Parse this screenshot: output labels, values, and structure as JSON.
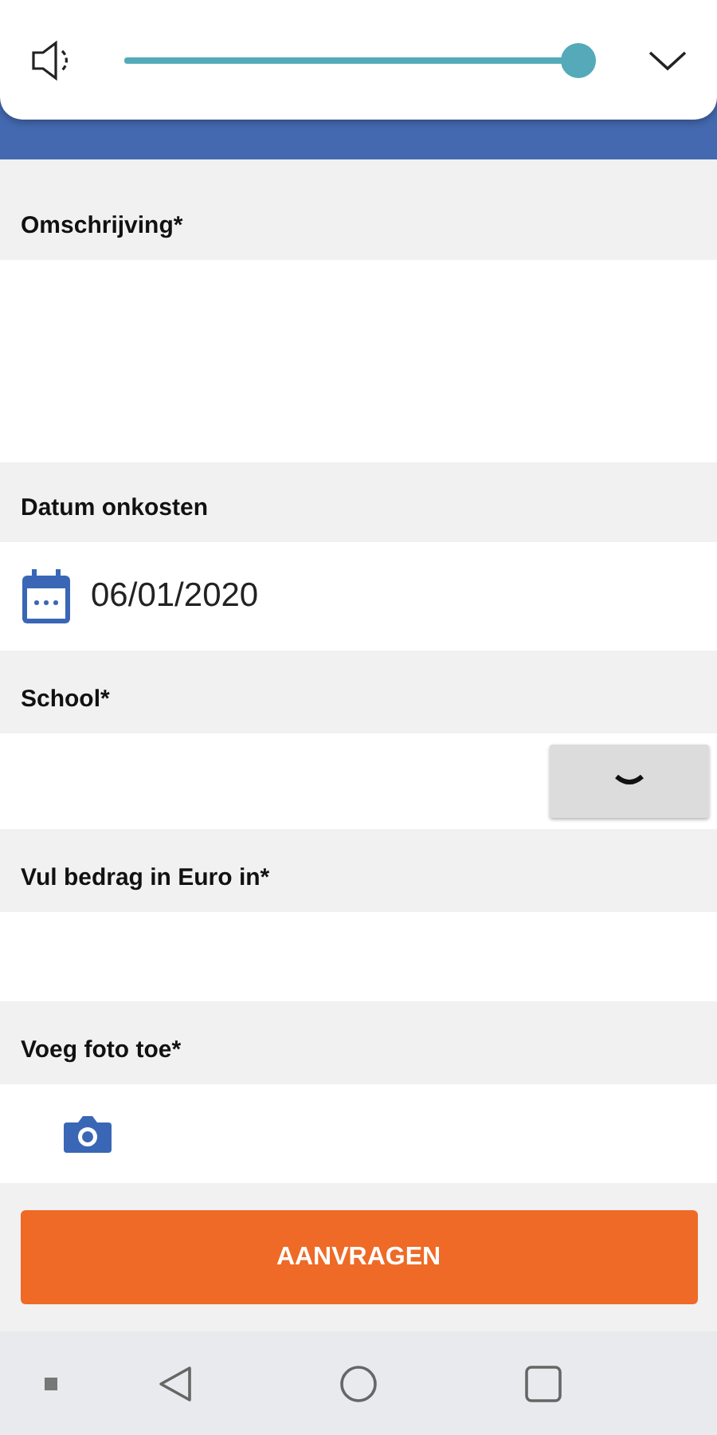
{
  "volume_panel": {
    "level": 1
  },
  "fields": [
    {
      "kind": "textarea",
      "label": "Omschrijving*"
    },
    {
      "kind": "date",
      "label": "Datum onkosten",
      "value": "06/01/2020"
    },
    {
      "kind": "select",
      "label": "School*"
    },
    {
      "kind": "text",
      "label": "Vul bedrag in Euro in*"
    },
    {
      "kind": "photo",
      "label": "Voeg foto toe*"
    }
  ],
  "submit_button": "AANVRAGEN"
}
